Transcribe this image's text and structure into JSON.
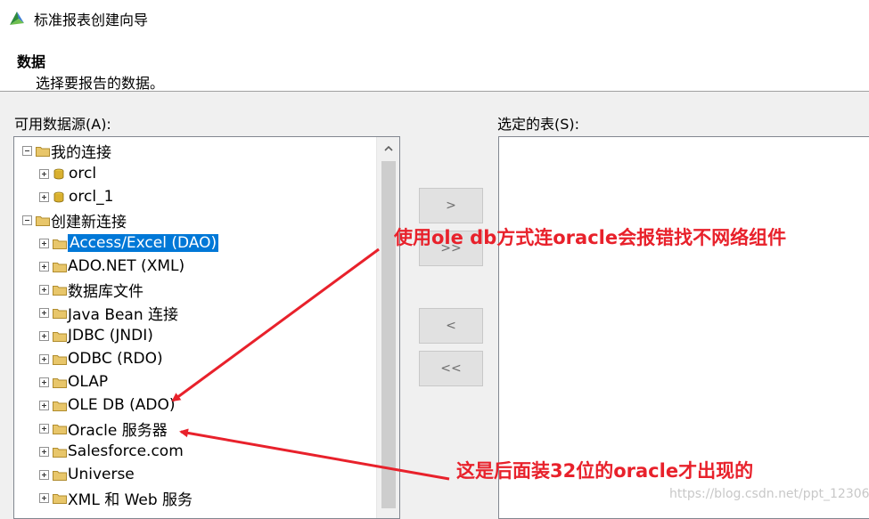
{
  "window": {
    "title": "标准报表创建向导"
  },
  "header": {
    "title": "数据",
    "subtitle": "选择要报告的数据。"
  },
  "available": {
    "label": "可用数据源(A):",
    "tree": [
      {
        "label": "我的连接",
        "expander": "minus",
        "icon": "folder",
        "level": 0
      },
      {
        "label": "orcl",
        "expander": "plus",
        "icon": "database",
        "level": 1
      },
      {
        "label": "orcl_1",
        "expander": "plus",
        "icon": "database",
        "level": 1
      },
      {
        "label": "创建新连接",
        "expander": "minus",
        "icon": "folder",
        "level": 0
      },
      {
        "label": "Access/Excel (DAO)",
        "expander": "plus",
        "icon": "folder",
        "level": 1,
        "selected": true
      },
      {
        "label": "ADO.NET (XML)",
        "expander": "plus",
        "icon": "folder",
        "level": 1
      },
      {
        "label": "数据库文件",
        "expander": "plus",
        "icon": "folder",
        "level": 1
      },
      {
        "label": "Java Bean 连接",
        "expander": "plus",
        "icon": "folder",
        "level": 1
      },
      {
        "label": "JDBC (JNDI)",
        "expander": "plus",
        "icon": "folder",
        "level": 1
      },
      {
        "label": "ODBC (RDO)",
        "expander": "plus",
        "icon": "folder",
        "level": 1
      },
      {
        "label": "OLAP",
        "expander": "plus",
        "icon": "folder",
        "level": 1
      },
      {
        "label": "OLE DB (ADO)",
        "expander": "plus",
        "icon": "folder",
        "level": 1
      },
      {
        "label": "Oracle 服务器",
        "expander": "plus",
        "icon": "folder",
        "level": 1
      },
      {
        "label": "Salesforce.com",
        "expander": "plus",
        "icon": "folder",
        "level": 1
      },
      {
        "label": "Universe",
        "expander": "plus",
        "icon": "folder",
        "level": 1
      },
      {
        "label": "XML 和 Web 服务",
        "expander": "plus",
        "icon": "folder",
        "level": 1
      }
    ]
  },
  "selected": {
    "label": "选定的表(S):"
  },
  "buttons": {
    "add": ">",
    "add_all": ">>",
    "remove": "<",
    "remove_all": "<<"
  },
  "annotations": {
    "note1": "使用ole db方式连oracle会报错找不网络组件",
    "note2": "这是后面装32位的oracle才出现的"
  },
  "watermark": "https://blog.csdn.net/ppt_12306",
  "colors": {
    "annotation": "#e8212b",
    "selection": "#0078d7",
    "folder": "#e8c66a"
  }
}
